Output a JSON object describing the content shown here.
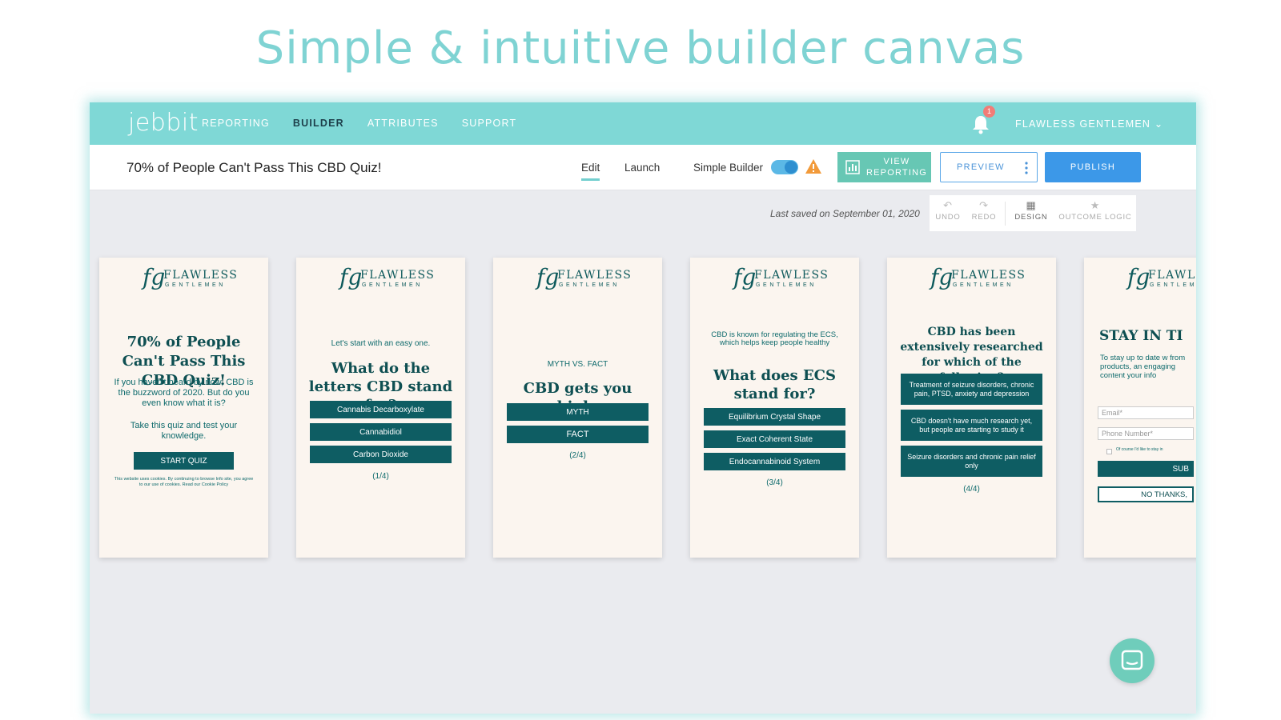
{
  "headline": "Simple & intuitive builder canvas",
  "nav": {
    "logo": "jebbit",
    "links": [
      "REPORTING",
      "BUILDER",
      "ATTRIBUTES",
      "SUPPORT"
    ],
    "notification_count": "1",
    "account": "FLAWLESS GENTLEMEN ⌄"
  },
  "toolbar": {
    "quiz_title": "70% of People Can't Pass This CBD Quiz!",
    "tab_edit": "Edit",
    "tab_launch": "Launch",
    "simple_builder_label": "Simple Builder",
    "view_reporting": "VIEW REPORTING",
    "preview": "PREVIEW",
    "publish": "PUBLISH"
  },
  "status": {
    "last_saved": "Last saved on September 01, 2020"
  },
  "actions": {
    "undo": "UNDO",
    "redo": "REDO",
    "design": "DESIGN",
    "outcome_logic": "OUTCOME LOGIC"
  },
  "brand": {
    "monogram": "fg",
    "name": "FLAWLESS",
    "sub": "GENTLEMEN"
  },
  "cards": {
    "intro": {
      "title": "70% of People Can't Pass This CBD Quiz!",
      "body": "If you haven't heard by now, CBD is the buzzword of 2020. But do you even know what it is?",
      "prompt": "Take this quiz and test your knowledge.",
      "button": "START QUIZ",
      "legal": "This website uses cookies. By continuing to browse Info site, you agree to our use of cookies. Read our Cookie Policy"
    },
    "q1": {
      "intro": "Let's start with an easy one.",
      "question": "What do the letters CBD stand for?",
      "options": [
        "Cannabis Decarboxylate",
        "Cannabidiol",
        "Carbon Dioxide"
      ],
      "progress": "(1/4)"
    },
    "q2": {
      "intro": "MYTH VS. FACT",
      "question": "CBD gets you high.",
      "options": [
        "MYTH",
        "FACT"
      ],
      "progress": "(2/4)"
    },
    "q3": {
      "intro": "CBD is known for regulating the ECS, which helps keep people healthy",
      "question": "What does ECS stand for?",
      "options": [
        "Equilibrium Crystal Shape",
        "Exact Coherent State",
        "Endocannabinoid System"
      ],
      "progress": "(3/4)"
    },
    "q4": {
      "question": "CBD has been extensively researched for which of the following?",
      "options": [
        "Treatment of seizure disorders, chronic pain, PTSD, anxiety and depression",
        "CBD doesn't have much research yet, but people are starting to study it",
        "Seizure disorders and chronic pain relief only"
      ],
      "progress": "(4/4)"
    },
    "signup": {
      "title": "STAY IN TI",
      "body": "To stay up to date w from products, an engaging content your info",
      "email_placeholder": "Email*",
      "phone_placeholder": "Phone Number*",
      "consent": "Of course I'd like to stay in",
      "submit": "SUB",
      "decline": "NO THANKS,"
    }
  },
  "colors": {
    "nav_bg": "#7fd8d6",
    "card_bg": "#fbf5ef",
    "brand_teal": "#0e5d63",
    "publish_blue": "#3c98e8",
    "headline": "#7fd3d3"
  }
}
